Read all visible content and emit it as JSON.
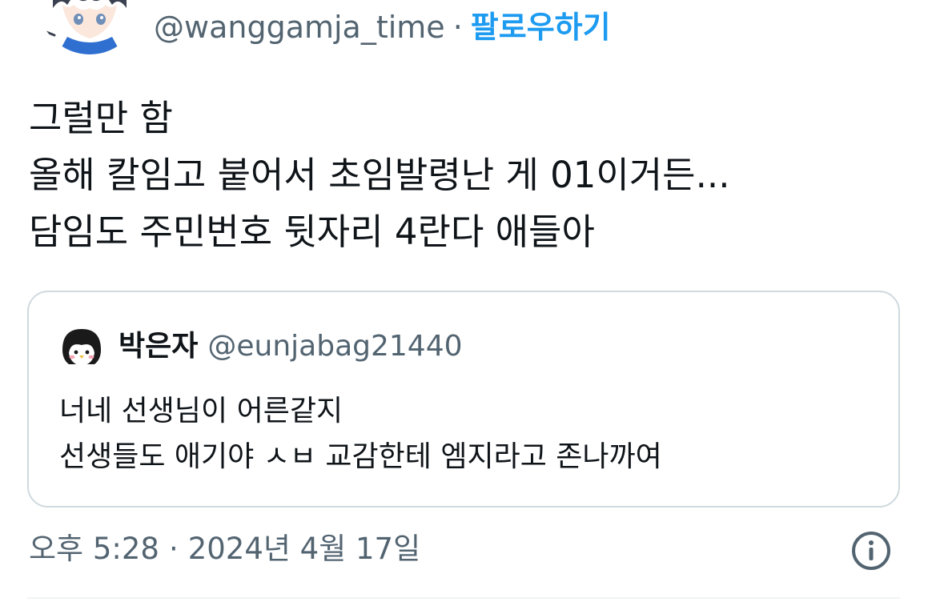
{
  "author": {
    "handle": "@wanggamja_time",
    "separator": "·",
    "follow_label": "팔로우하기"
  },
  "tweet": {
    "lines": [
      "그럴만 함",
      "올해 칼임고 붙어서 초임발령난 게 01이거든...",
      "담임도 주민번호 뒷자리 4란다 애들아"
    ]
  },
  "quote": {
    "name": "박은자",
    "handle": "@eunjabag21440",
    "lines": [
      "너네 선생님이 어른같지",
      "선생들도 애기야 ㅅㅂ 교감한테 엠지라고 존나까여"
    ]
  },
  "meta": {
    "time": "오후 5:28",
    "separator": "·",
    "date": "2024년 4월 17일"
  },
  "icons": {
    "info": "info-icon",
    "author_avatar": "anime-character-avatar",
    "quote_avatar": "penguin-avatar"
  },
  "colors": {
    "accent": "#1d9bf0",
    "secondary_text": "#536471",
    "border": "#cfd9de"
  }
}
